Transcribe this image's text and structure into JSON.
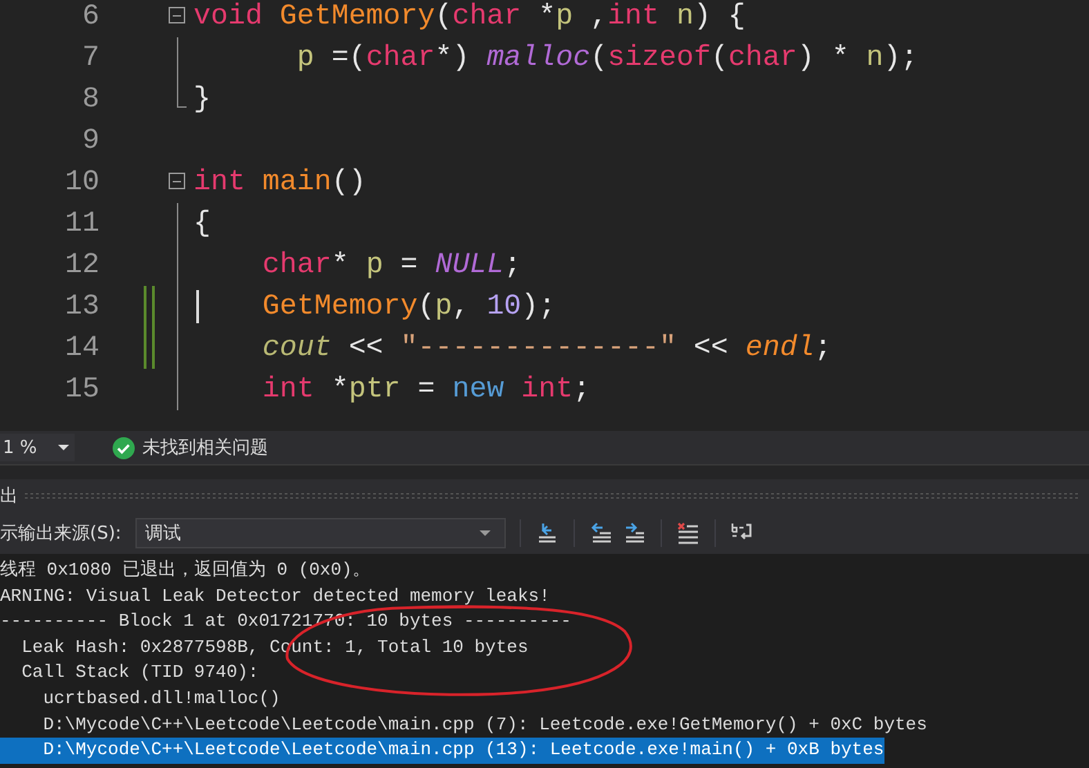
{
  "editor": {
    "lines": [
      {
        "number": "6",
        "collapsible": true,
        "tokens": [
          {
            "t": "void ",
            "kind": "kw"
          },
          {
            "t": "GetMemory",
            "kind": "fn"
          },
          {
            "t": "(",
            "kind": "plain"
          },
          {
            "t": "char",
            "kind": "kw"
          },
          {
            "t": " *",
            "kind": "plain"
          },
          {
            "t": "p",
            "kind": "var"
          },
          {
            "t": " ,",
            "kind": "plain"
          },
          {
            "t": "int ",
            "kind": "kw"
          },
          {
            "t": "n",
            "kind": "var"
          },
          {
            "t": ") {",
            "kind": "plain"
          }
        ]
      },
      {
        "number": "7",
        "guide": true,
        "tokens": [
          {
            "t": "      p",
            "kind": "var"
          },
          {
            "t": " =(",
            "kind": "plain"
          },
          {
            "t": "char",
            "kind": "kw"
          },
          {
            "t": "*) ",
            "kind": "plain"
          },
          {
            "t": "malloc",
            "kind": "macro"
          },
          {
            "t": "(",
            "kind": "plain"
          },
          {
            "t": "sizeof",
            "kind": "kw"
          },
          {
            "t": "(",
            "kind": "plain"
          },
          {
            "t": "char",
            "kind": "kw"
          },
          {
            "t": ") * ",
            "kind": "plain"
          },
          {
            "t": "n",
            "kind": "var"
          },
          {
            "t": ");",
            "kind": "plain"
          }
        ]
      },
      {
        "number": "8",
        "block_end": true,
        "tokens": [
          {
            "t": "}",
            "kind": "plain"
          }
        ]
      },
      {
        "number": "9"
      },
      {
        "number": "10",
        "collapsible": true,
        "tokens": [
          {
            "t": "int ",
            "kind": "kw"
          },
          {
            "t": "main",
            "kind": "fn"
          },
          {
            "t": "()",
            "kind": "plain"
          }
        ]
      },
      {
        "number": "11",
        "guide": true,
        "tokens": [
          {
            "t": "{",
            "kind": "plain"
          }
        ]
      },
      {
        "number": "12",
        "guide": true,
        "tokens": [
          {
            "t": "    char",
            "kind": "kw"
          },
          {
            "t": "* ",
            "kind": "plain"
          },
          {
            "t": "p",
            "kind": "var"
          },
          {
            "t": " = ",
            "kind": "plain"
          },
          {
            "t": "NULL",
            "kind": "macro"
          },
          {
            "t": ";",
            "kind": "plain"
          }
        ]
      },
      {
        "number": "13",
        "guide": true,
        "changed": true,
        "cursor": true,
        "tokens": [
          {
            "t": "    GetMemory",
            "kind": "fn"
          },
          {
            "t": "(",
            "kind": "plain"
          },
          {
            "t": "p",
            "kind": "var"
          },
          {
            "t": ", ",
            "kind": "plain"
          },
          {
            "t": "10",
            "kind": "num"
          },
          {
            "t": ");",
            "kind": "plain"
          }
        ]
      },
      {
        "number": "14",
        "guide": true,
        "changed": true,
        "tokens": [
          {
            "t": "    cout",
            "kind": "stream"
          },
          {
            "t": " << ",
            "kind": "plain"
          },
          {
            "t": "\"--------------\"",
            "kind": "str"
          },
          {
            "t": " << ",
            "kind": "plain"
          },
          {
            "t": "endl",
            "kind": "manip"
          },
          {
            "t": ";",
            "kind": "plain"
          }
        ]
      },
      {
        "number": "15",
        "guide": true,
        "tokens": [
          {
            "t": "    int",
            "kind": "kw"
          },
          {
            "t": " *",
            "kind": "plain"
          },
          {
            "t": "ptr",
            "kind": "var"
          },
          {
            "t": " = ",
            "kind": "plain"
          },
          {
            "t": "new",
            "kind": "op"
          },
          {
            "t": " int",
            "kind": "kw"
          },
          {
            "t": ";",
            "kind": "plain"
          }
        ]
      }
    ]
  },
  "status_bar": {
    "zoom": "1 %",
    "issues": "未找到相关问题"
  },
  "output_panel": {
    "title": "出",
    "source_label": "示输出来源(S):",
    "source_value": "调试",
    "lines": [
      {
        "text": "线程 0x1080 已退出，返回值为 0 (0x0)。",
        "selected": false
      },
      {
        "text": "ARNING: Visual Leak Detector detected memory leaks!",
        "selected": false
      },
      {
        "text": "---------- Block 1 at 0x01721770: 10 bytes ----------",
        "selected": false
      },
      {
        "text": "  Leak Hash: 0x2877598B, Count: 1, Total 10 bytes",
        "selected": false
      },
      {
        "text": "  Call Stack (TID 9740):",
        "selected": false
      },
      {
        "text": "    ucrtbased.dll!malloc()",
        "selected": false
      },
      {
        "text": "    D:\\Mycode\\C++\\Leetcode\\Leetcode\\main.cpp (7): Leetcode.exe!GetMemory() + 0xC bytes",
        "selected": false
      },
      {
        "text": "    D:\\Mycode\\C++\\Leetcode\\Leetcode\\main.cpp (13): Leetcode.exe!main() + 0xB bytes",
        "selected": true
      }
    ]
  }
}
